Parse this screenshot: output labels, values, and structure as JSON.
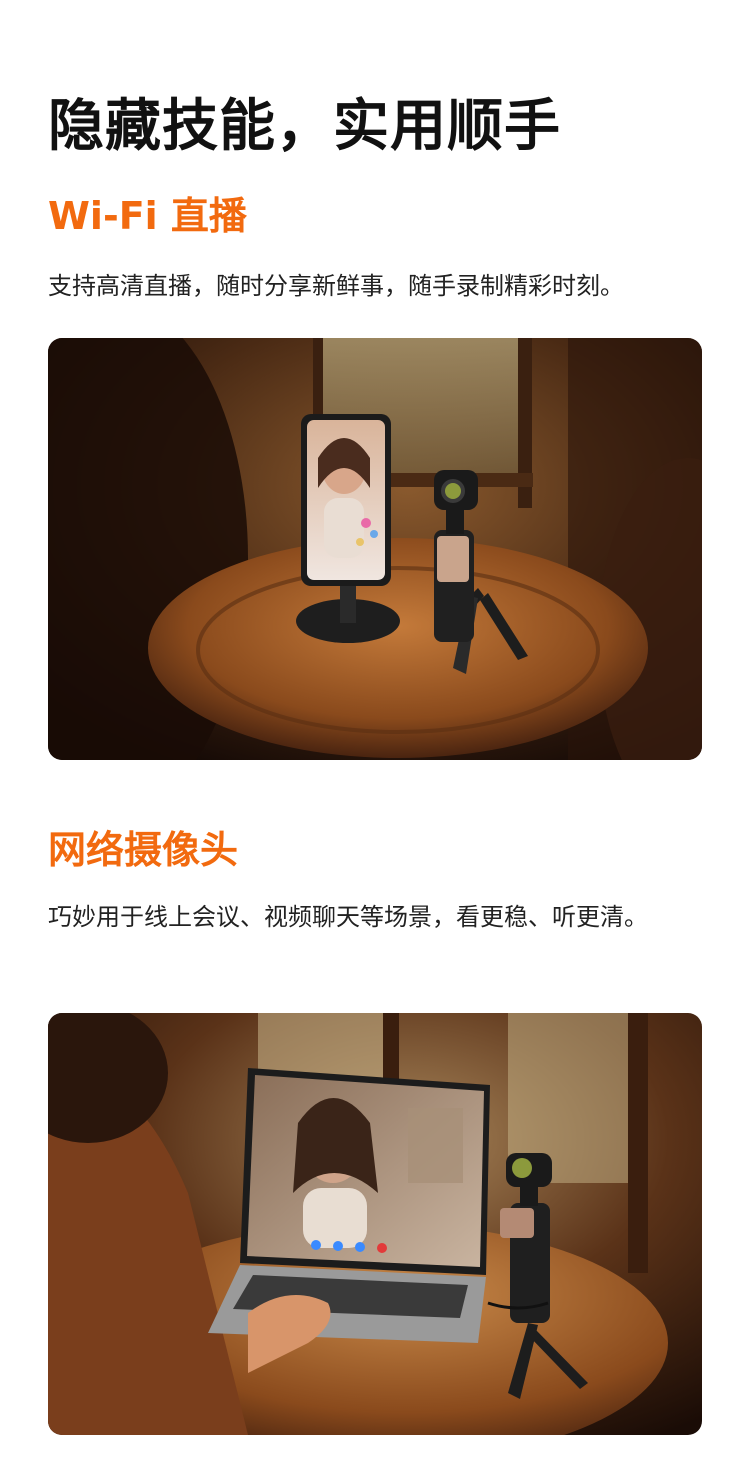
{
  "page_title": "隐藏技能，实用顺手",
  "sections": [
    {
      "title": "Wi-Fi 直播",
      "description": "支持高清直播，随时分享新鲜事，随手录制精彩时刻。",
      "image_alt": "Phone on a stand livestreaming beside a pocket gimbal camera on a round wooden table"
    },
    {
      "title": "网络摄像头",
      "description": "巧妙用于线上会议、视频聊天等场景，看更稳、听更清。",
      "image_alt": "Laptop video call using a pocket gimbal camera on a mini tripod as a webcam"
    }
  ]
}
